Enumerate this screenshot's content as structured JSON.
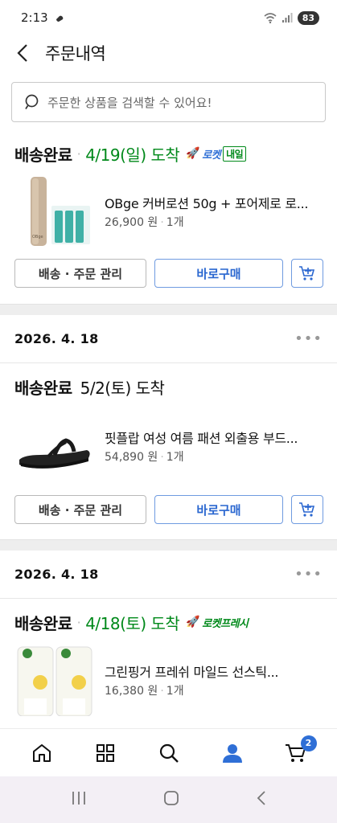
{
  "status_bar": {
    "time": "2:13",
    "battery": "83"
  },
  "header": {
    "title": "주문내역"
  },
  "search": {
    "placeholder": "주문한 상품을 검색할 수 있어요!"
  },
  "orders": [
    {
      "date": "",
      "status": "배송완료",
      "arrival": "4/19(일) 도착",
      "badge": "로켓",
      "badge_extra": "내일",
      "product_name": "OBge 커버로션 50g + 포어제로 로...",
      "price": "26,900 원",
      "qty": "1개",
      "thumb_text": "OBge"
    },
    {
      "date": "2026. 4. 18",
      "status": "배송완료",
      "arrival": "5/2(토) 도착",
      "product_name": "핏플랍 여성 여름 패션 외출용 부드...",
      "price": "54,890 원",
      "qty": "1개"
    },
    {
      "date": "2026. 4. 18",
      "status": "배송완료",
      "arrival": "4/18(토) 도착",
      "badge": "로켓프레시",
      "product_name": "그린핑거 프레쉬 마일드 선스틱...",
      "price": "16,380 원",
      "qty": "1개"
    }
  ],
  "buttons": {
    "manage": "배송 · 주문 관리",
    "buy_again": "바로구매"
  },
  "bottom_nav": {
    "cart_count": "2"
  },
  "colors": {
    "accent_blue": "#2f6fd6",
    "arrival_green": "#00891a"
  }
}
